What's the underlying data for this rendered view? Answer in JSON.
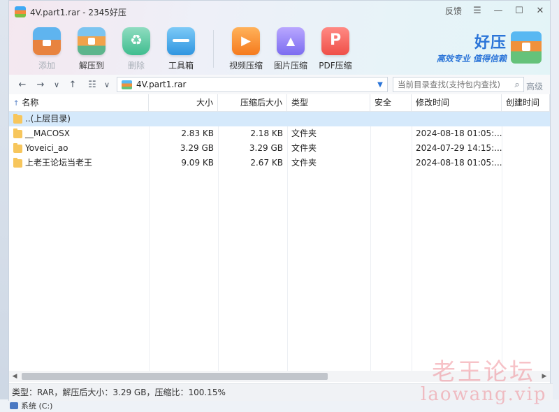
{
  "window": {
    "title": "4V.part1.rar - 2345好压"
  },
  "title_controls": {
    "feedback": "反馈",
    "menu": "☰",
    "minimize": "—",
    "maximize": "☐",
    "close": "✕"
  },
  "toolbar": [
    {
      "label": "添加",
      "icon": "add-icon",
      "enabled": false
    },
    {
      "label": "解压到",
      "icon": "extract-icon",
      "enabled": true
    },
    {
      "label": "删除",
      "icon": "delete-icon",
      "enabled": false
    },
    {
      "label": "工具箱",
      "icon": "toolbox-icon",
      "enabled": true
    },
    {
      "label": "视频压缩",
      "icon": "video-compress-icon",
      "enabled": true
    },
    {
      "label": "图片压缩",
      "icon": "image-compress-icon",
      "enabled": true
    },
    {
      "label": "PDF压缩",
      "icon": "pdf-compress-icon",
      "enabled": true
    }
  ],
  "brand": {
    "name": "好压",
    "slogan": "高效专业  值得信赖"
  },
  "nav": {
    "back": "←",
    "forward": "→",
    "history": "∨",
    "up": "↑",
    "view": "☷",
    "view_drop": "∨"
  },
  "path": {
    "value": "4V.part1.rar",
    "dropdown": "▼"
  },
  "search": {
    "placeholder": "当前目录查找(支持包内查找)",
    "icon": "⌕",
    "advanced": "高级"
  },
  "columns": {
    "name": "名称",
    "size": "大小",
    "packed": "压缩后大小",
    "type": "类型",
    "security": "安全",
    "modified": "修改时间",
    "created": "创建时间",
    "sort_indicator": "↑"
  },
  "rows": [
    {
      "name": "..(上层目录)",
      "size": "",
      "packed": "",
      "type": "",
      "security": "",
      "modified": "",
      "selected": true
    },
    {
      "name": "__MACOSX",
      "size": "2.83 KB",
      "packed": "2.18 KB",
      "type": "文件夹",
      "security": "",
      "modified": "2024-08-18 01:05:...",
      "selected": false
    },
    {
      "name": "Yoveici_ao",
      "size": "3.29 GB",
      "packed": "3.29 GB",
      "type": "文件夹",
      "security": "",
      "modified": "2024-07-29 14:15:...",
      "selected": false
    },
    {
      "name": "上老王论坛当老王",
      "size": "9.09 KB",
      "packed": "2.67 KB",
      "type": "文件夹",
      "security": "",
      "modified": "2024-08-18 01:05:...",
      "selected": false
    }
  ],
  "scrollbar": {
    "left": "◀",
    "right": "▶"
  },
  "status": {
    "text": "类型：RAR，解压后大小：3.29 GB，压缩比：100.15%"
  },
  "watermark": {
    "line1": "老王论坛",
    "line2": "laowang.vip"
  },
  "desktop": {
    "drive_label": "系统 (C:)"
  }
}
